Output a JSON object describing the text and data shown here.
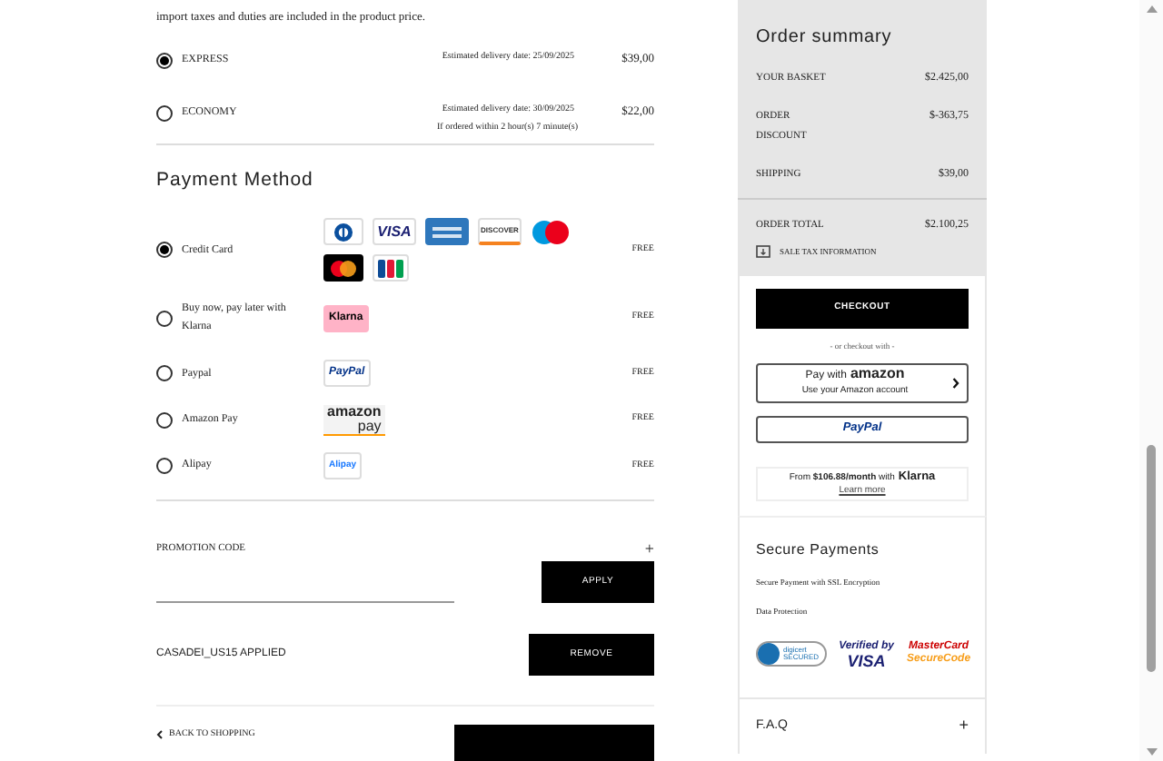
{
  "intro": "import taxes and duties are included in the product price.",
  "shipping": [
    {
      "name": "EXPRESS",
      "estimate": "Estimated delivery date: 25/09/2025",
      "price": "$39,00",
      "selected": true
    },
    {
      "name": "ECONOMY",
      "estimate": "Estimated delivery date: 30/09/2025",
      "note": "If ordered within 2 hour(s) 7 minute(s)",
      "price": "$22,00",
      "selected": false
    }
  ],
  "payment": {
    "title": "Payment Method",
    "methods": [
      {
        "label": "Credit Card",
        "selected": true,
        "fee": "FREE",
        "logos": [
          {
            "kind": "diners"
          },
          {
            "kind": "visa",
            "label": "VISA"
          },
          {
            "kind": "amex"
          },
          {
            "kind": "discover",
            "label": "DISCOVER"
          },
          {
            "kind": "maestro"
          },
          {
            "kind": "mastercard"
          },
          {
            "kind": "jcb"
          }
        ]
      },
      {
        "label": "Buy now, pay later with Klarna",
        "selected": false,
        "fee": "FREE",
        "logos": [
          {
            "kind": "klarna",
            "label": "Klarna"
          }
        ]
      },
      {
        "label": "Paypal",
        "selected": false,
        "fee": "FREE",
        "logos": [
          {
            "kind": "paypal",
            "label": "PayPal"
          }
        ]
      },
      {
        "label": "Amazon Pay",
        "selected": false,
        "fee": "FREE",
        "logos": [
          {
            "kind": "amazon",
            "label": "amazon",
            "sub": "pay"
          }
        ]
      },
      {
        "label": "Alipay",
        "selected": false,
        "fee": "FREE",
        "logos": [
          {
            "kind": "alipay",
            "label": "Alipay"
          }
        ]
      }
    ]
  },
  "promo": {
    "title": "PROMOTION CODE",
    "toggle": "+",
    "apply": "APPLY",
    "applied": "CASADEI_US15 APPLIED",
    "remove": "REMOVE"
  },
  "back": "BACK TO SHOPPING",
  "summary": {
    "title": "Order summary",
    "rows": [
      {
        "label": "YOUR BASKET",
        "value": "$2.425,00"
      },
      {
        "label": "ORDER DISCOUNT",
        "value": "$-363,75"
      },
      {
        "label": "SHIPPING",
        "value": "$39,00"
      }
    ],
    "total": {
      "label": "ORDER TOTAL",
      "value": "$2.100,25"
    },
    "tax": "SALE TAX INFORMATION"
  },
  "checkout": {
    "button": "CHECKOUT",
    "or": "- or checkout with -",
    "amazon": {
      "title": "Pay with",
      "brand": "amazon",
      "sub": "Use your Amazon account"
    },
    "paypal": "PayPal",
    "klarna": {
      "text": "From **$106.88/month** with",
      "brand": "Klarna",
      "link": "Learn more"
    }
  },
  "secure": {
    "title": "Secure Payments",
    "lines": [
      "Secure Payment with SSL Encryption",
      "Data Protection"
    ],
    "badges": [
      {
        "kind": "digicert",
        "label": "digicert",
        "sub": "SECURED"
      },
      {
        "kind": "vbv",
        "label": "Verified by",
        "sub": "VISA"
      },
      {
        "kind": "mcsc",
        "label": "MasterCard",
        "sub": "SecureCode"
      }
    ]
  },
  "faq": {
    "title": "F.A.Q",
    "toggle": "+"
  }
}
